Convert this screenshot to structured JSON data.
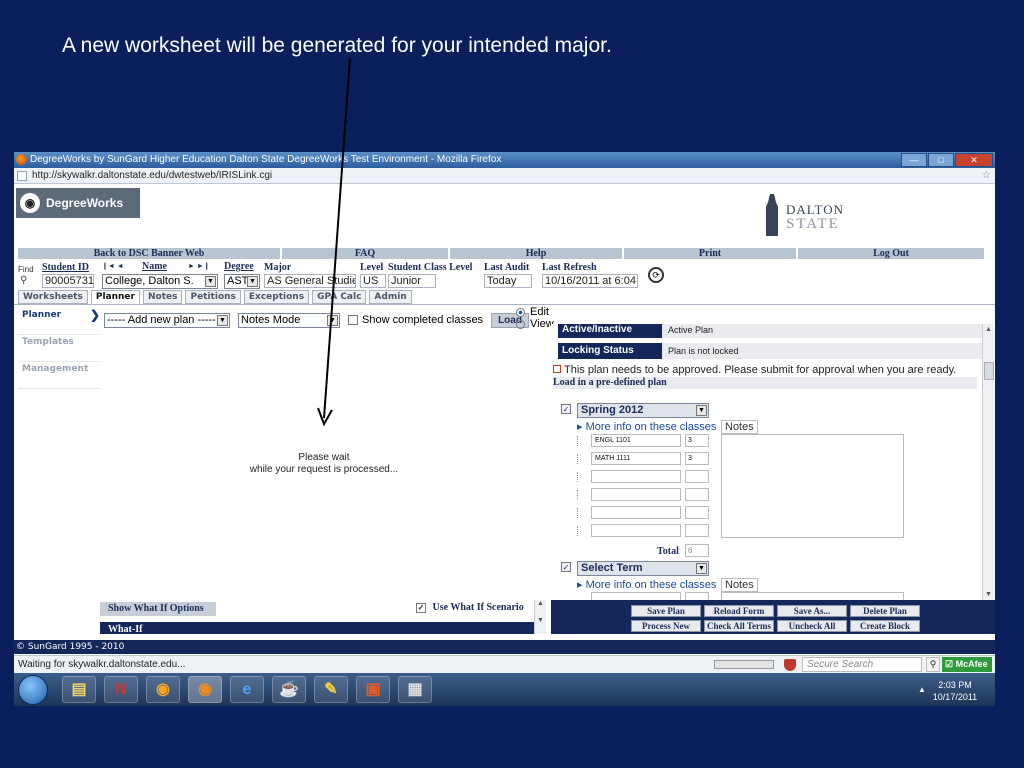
{
  "slide": {
    "title": "A new worksheet will be generated for your intended major."
  },
  "browser": {
    "window_title": "DegreeWorks by SunGard Higher Education Dalton State DegreeWorks Test Environment - Mozilla Firefox",
    "url": "http://skywalkr.daltonstate.edu/dwtestweb/IRISLink.cgi",
    "status_text": "Waiting for skywalkr.daltonstate.edu...",
    "search_placeholder": "Secure Search",
    "mcafee_label": "McAfee"
  },
  "header": {
    "logo_text": "DegreeWorks",
    "school_line1": "DALTON",
    "school_line2": "STATE"
  },
  "nav": {
    "items": [
      "Back to DSC Banner Web",
      "FAQ",
      "Help",
      "Print",
      "Log Out"
    ]
  },
  "student": {
    "find_label": "Find",
    "id_label": "Student ID",
    "id_value": "90005731",
    "name_label": "Name",
    "name_nav": "❙◄  ◄",
    "name_nav_right": "►  ►❙",
    "name_value": "College, Dalton S.",
    "degree_label": "Degree",
    "degree_value": "ASTI",
    "major_label": "Major",
    "major_value": "AS General Studies",
    "level_label": "Level",
    "level_value": "US",
    "class_label": "Student Class Level",
    "class_value": "Junior",
    "audit_label": "Last Audit",
    "audit_value": "Today",
    "refresh_label": "Last Refresh",
    "refresh_value": "10/16/2011 at 6:04"
  },
  "tabs": [
    "Worksheets",
    "Planner",
    "Notes",
    "Petitions",
    "Exceptions",
    "GPA Calc",
    "Admin"
  ],
  "sidebar": {
    "items": [
      "Planner",
      "Templates",
      "Management"
    ]
  },
  "planner_controls": {
    "plan_select": "----- Add new plan -----",
    "mode_select": "Notes Mode",
    "show_completed": "Show completed classes",
    "load_button": "Load",
    "radio_edit": "Edit",
    "radio_view": "View"
  },
  "wait": {
    "line1": "Please wait",
    "line2": "while your request is processed..."
  },
  "what_if": {
    "options_button": "Show What If Options",
    "use_label": "Use What If Scenario",
    "section_title": "What-If"
  },
  "plan": {
    "active_key": "Active/Inactive",
    "active_val": "Active Plan",
    "lock_key": "Locking Status",
    "lock_val": "Plan is not locked",
    "approve_msg": "This plan needs to be approved. Please submit for approval when you are ready.",
    "predef_label": "Load in a pre-defined plan",
    "more_info": "More info on these classes",
    "notes_label": "Notes",
    "total_label": "Total",
    "terms": [
      {
        "name": "Spring 2012",
        "courses": [
          {
            "course": "ENGL 1101",
            "credits": "3"
          },
          {
            "course": "MATH 1111",
            "credits": "3"
          },
          {
            "course": "",
            "credits": ""
          },
          {
            "course": "",
            "credits": ""
          },
          {
            "course": "",
            "credits": ""
          },
          {
            "course": "",
            "credits": ""
          }
        ],
        "total": "6"
      },
      {
        "name": "Select Term",
        "courses": [],
        "total": ""
      }
    ]
  },
  "actions": {
    "row1": [
      "Save Plan",
      "Reload Form",
      "Save As...",
      "Delete Plan"
    ],
    "row2": [
      "Process New",
      "Check All Terms",
      "Uncheck All",
      "Create Block"
    ]
  },
  "footer": {
    "copyright": "© SunGard 1995 - 2010"
  },
  "taskbar": {
    "time": "2:03 PM",
    "date": "10/17/2011"
  },
  "colors": {
    "slide_bg": "#0b1f5c",
    "dw_navy": "#13275a",
    "nav_gray": "#b9c4d1"
  }
}
